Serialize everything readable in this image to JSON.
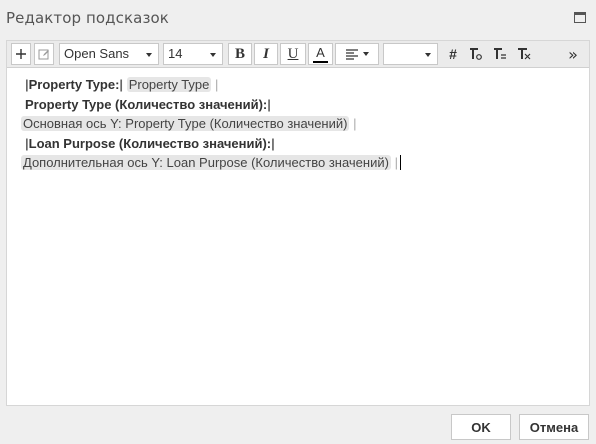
{
  "window": {
    "title": "Редактор подсказок"
  },
  "toolbar": {
    "font_family": "Open Sans",
    "font_size": "14",
    "bold_label": "B",
    "italic_label": "I",
    "underline_label": "U",
    "color_label": "A",
    "hash_label": "#",
    "more_label": "»",
    "icons": [
      "plus-icon",
      "edit-icon",
      "align-left-icon",
      "insert-field-icon",
      "insert-field-alt-icon",
      "clear-format-icon"
    ]
  },
  "content": {
    "lines": [
      {
        "label": "Property Type:",
        "chip": "Property Type"
      },
      {
        "label": "Property Type (Количество значений):"
      },
      {
        "chip": "Основная ось Y: Property Type (Количество значений)"
      },
      {
        "label": "Loan Purpose (Количество значений):"
      },
      {
        "chip": "Дополнительная ось Y: Loan Purpose (Количество значений)"
      }
    ],
    "separator": "|"
  },
  "footer": {
    "ok_label": "OK",
    "cancel_label": "Отмена"
  },
  "colors": {
    "background": "#efefef",
    "editor": "#ffffff",
    "toolbar": "#ebebeb",
    "chip": "#e6e6e6"
  }
}
